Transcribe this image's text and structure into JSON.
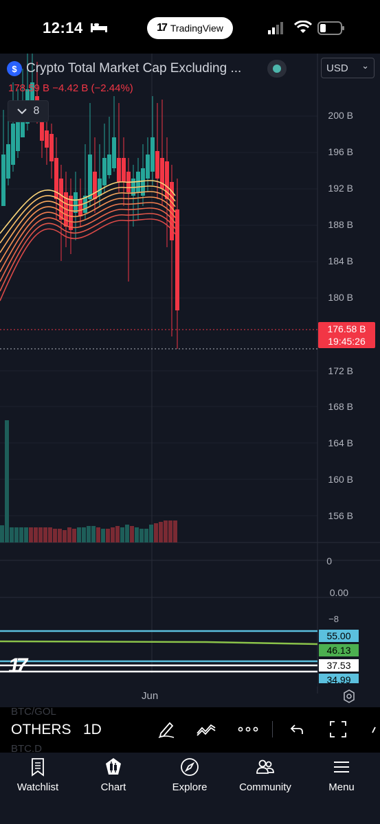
{
  "status_bar": {
    "time": "12:14",
    "app_pill": "TradingView",
    "pill_logo": "17"
  },
  "chart_header": {
    "symbol_title": "Crypto Total Market Cap Excluding ...",
    "ohlc_line": "178.59 B  −4.42 B (−2.44%)",
    "indicators_count": "8",
    "currency": "USD",
    "currency_caret": "⌄",
    "symbol_icon": "$"
  },
  "price_axis": [
    "200 B",
    "196 B",
    "192 B",
    "188 B",
    "184 B",
    "180 B",
    "172 B",
    "168 B",
    "164 B",
    "160 B",
    "156 B"
  ],
  "price_tag": {
    "price": "176.58 B",
    "countdown": "19:45:26"
  },
  "indicator_axis": {
    "top_label": "0",
    "mid_label": "0.00",
    "bottom_label": "−8"
  },
  "indicator_badges": [
    "55.00",
    "46.13",
    "37.53",
    "34.99"
  ],
  "x_axis": {
    "label": "Jun"
  },
  "watermark": "17",
  "toolbar": {
    "symbol": "OTHERS",
    "interval": "1D",
    "ghost_above": "BTC/GOL",
    "ghost_below": "BTC.D"
  },
  "tabs": [
    {
      "label": "Watchlist",
      "icon": "bookmark-icon"
    },
    {
      "label": "Chart",
      "icon": "candles-icon"
    },
    {
      "label": "Explore",
      "icon": "compass-icon"
    },
    {
      "label": "Community",
      "icon": "people-icon"
    },
    {
      "label": "Menu",
      "icon": "hamburger-icon"
    }
  ],
  "colors": {
    "up": "#26a69a",
    "down": "#f23645",
    "background": "#131722",
    "accent": "#2962ff"
  }
}
